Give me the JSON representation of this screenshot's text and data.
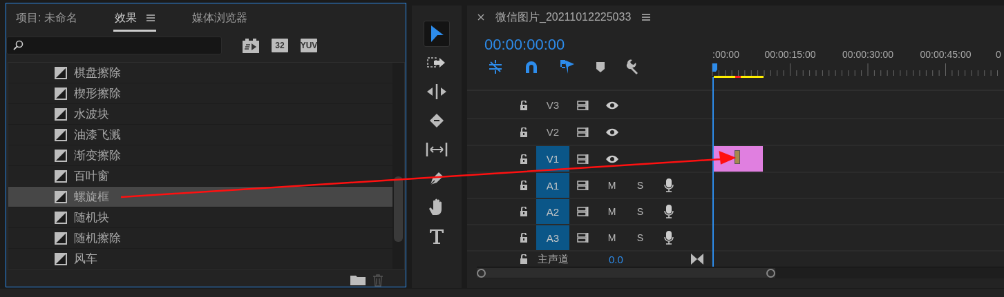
{
  "project_panel": {
    "tabs": [
      {
        "label": "项目: 未命名",
        "selected": false,
        "menu": false
      },
      {
        "label": "效果",
        "selected": true,
        "menu": true
      },
      {
        "label": "媒体浏览器",
        "selected": false,
        "menu": false
      }
    ],
    "filter_buttons": [
      {
        "kind": "accelerated"
      },
      {
        "kind": "text",
        "label": "32"
      },
      {
        "kind": "text",
        "label": "YUV"
      }
    ],
    "effects": [
      {
        "name": "棋盘擦除",
        "selected": false
      },
      {
        "name": "楔形擦除",
        "selected": false
      },
      {
        "name": "水波块",
        "selected": false
      },
      {
        "name": "油漆飞溅",
        "selected": false
      },
      {
        "name": "渐变擦除",
        "selected": false
      },
      {
        "name": "百叶窗",
        "selected": false
      },
      {
        "name": "螺旋框",
        "selected": true
      },
      {
        "name": "随机块",
        "selected": false
      },
      {
        "name": "随机擦除",
        "selected": false
      },
      {
        "name": "风车",
        "selected": false
      }
    ]
  },
  "tools": [
    {
      "kind": "selection",
      "selected": true
    },
    {
      "kind": "track-select",
      "selected": false
    },
    {
      "kind": "ripple",
      "selected": false
    },
    {
      "kind": "razor",
      "selected": false
    },
    {
      "kind": "slip",
      "selected": false
    },
    {
      "kind": "pen",
      "selected": false
    },
    {
      "kind": "hand",
      "selected": false
    },
    {
      "kind": "type",
      "selected": false
    }
  ],
  "sequence": {
    "title": "微信图片_20211012225033",
    "timecode": "00:00:00:00",
    "ruler_labels": [
      ":00:00",
      "00:00:15:00",
      "00:00:30:00",
      "00:00:45:00",
      "0"
    ],
    "tracks": [
      {
        "name": "V3",
        "kind": "video",
        "targeted": false,
        "has_clip": false
      },
      {
        "name": "V2",
        "kind": "video",
        "targeted": false,
        "has_clip": false
      },
      {
        "name": "V1",
        "kind": "video",
        "targeted": true,
        "has_clip": true
      },
      {
        "name": "A1",
        "kind": "audio",
        "targeted": true,
        "has_clip": false,
        "mute": "M",
        "solo": "S"
      },
      {
        "name": "A2",
        "kind": "audio",
        "targeted": true,
        "has_clip": false,
        "mute": "M",
        "solo": "S"
      },
      {
        "name": "A3",
        "kind": "audio",
        "targeted": true,
        "has_clip": false,
        "mute": "M",
        "solo": "S"
      }
    ],
    "master": {
      "name": "主声道",
      "value": "0.0"
    }
  }
}
